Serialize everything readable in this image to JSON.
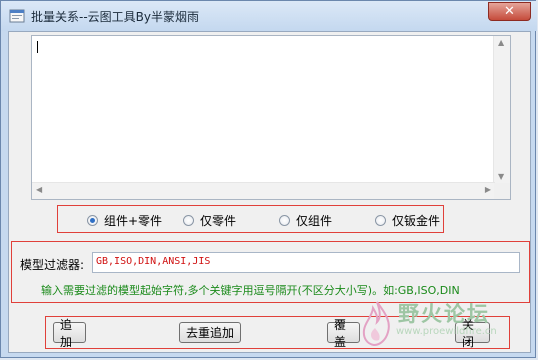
{
  "window": {
    "title": "批量关系--云图工具By半蒙烟雨",
    "close_glyph": "✕"
  },
  "editor": {
    "value": ""
  },
  "mode_options": [
    {
      "label": "组件+零件",
      "checked": true
    },
    {
      "label": "仅零件",
      "checked": false
    },
    {
      "label": "仅组件",
      "checked": false
    },
    {
      "label": "仅钣金件",
      "checked": false
    }
  ],
  "filter": {
    "label": "模型过滤器:",
    "value": "GB,ISO,DIN,ANSI,JIS",
    "hint": "输入需要过滤的模型起始字符,多个关键字用逗号隔开(不区分大小写)。如:GB,ISO,DIN"
  },
  "buttons": {
    "append": "追加",
    "dedupe_append": "去重追加",
    "overwrite": "覆盖",
    "close": "关闭"
  },
  "watermark": {
    "text": "野火论坛",
    "url": "www.proewildfire.cn"
  },
  "colors": {
    "highlight_border": "#e0403a",
    "hint_text": "#1a8a1a",
    "filter_text": "#d01010",
    "radio_selected": "#2f6fc5"
  }
}
